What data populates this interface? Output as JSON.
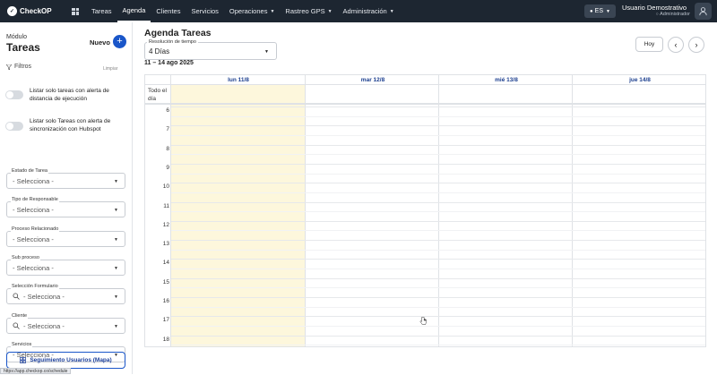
{
  "app": {
    "logo_text": "CheckOP",
    "nav": [
      {
        "label": "Tareas",
        "dropdown": false
      },
      {
        "label": "Agenda",
        "dropdown": false,
        "active": true
      },
      {
        "label": "Clientes",
        "dropdown": false
      },
      {
        "label": "Servicios",
        "dropdown": false
      },
      {
        "label": "Operaciones",
        "dropdown": true
      },
      {
        "label": "Rastreo GPS",
        "dropdown": true
      },
      {
        "label": "Administración",
        "dropdown": true
      }
    ],
    "language": "ES",
    "user_name": "Usuario Demostrativo",
    "user_role": "Administrador"
  },
  "sidebar": {
    "module_label": "Módulo",
    "module_title": "Tareas",
    "new_label": "Nuevo",
    "filters_label": "Filtros",
    "clear_label": "Limpiar",
    "toggles": [
      {
        "label": "Listar solo tareas con alerta de distancia de ejecución",
        "on": false
      },
      {
        "label": "Listar solo Tareas con alerta de sincronización con Hubspot",
        "on": false
      }
    ],
    "filters": [
      {
        "label": "Estado de Tarea",
        "value": "- Selecciona -",
        "search": false
      },
      {
        "label": "Tipo de Responsable",
        "value": "- Selecciona -",
        "search": false
      },
      {
        "label": "Proceso Relacionado",
        "value": "- Selecciona -",
        "search": false
      },
      {
        "label": "Sub proceso",
        "value": "- Selecciona -",
        "search": false
      },
      {
        "label": "Selección Formulario",
        "value": "- Selecciona -",
        "search": true
      },
      {
        "label": "Cliente",
        "value": "- Selecciona -",
        "search": true
      },
      {
        "label": "Servicios",
        "value": "- Selecciona -",
        "search": false
      }
    ],
    "map_button": "Seguimiento Usuarios (Mapa)",
    "status_url": "https://app.checkop.co/schedule"
  },
  "main": {
    "title": "Agenda Tareas",
    "resolution_label": "Resolución de tiempo",
    "resolution_value": "4 Días",
    "date_range": "11 – 14 ago 2025",
    "today_button": "Hoy",
    "prev_icon": "‹",
    "next_icon": "›"
  },
  "calendar": {
    "days": [
      "lun 11/8",
      "mar 12/8",
      "mié 13/8",
      "jue 14/8"
    ],
    "today_index": 0,
    "all_day_label": "Todo el día",
    "hours": [
      "6",
      "7",
      "8",
      "9",
      "10",
      "11",
      "12",
      "13",
      "14",
      "15",
      "16",
      "17",
      "18"
    ]
  },
  "colors": {
    "topbar": "#1d2631",
    "accent": "#1a56c9",
    "today_highlight": "#fdf7dc",
    "day_header_text": "#1c3f8f"
  }
}
